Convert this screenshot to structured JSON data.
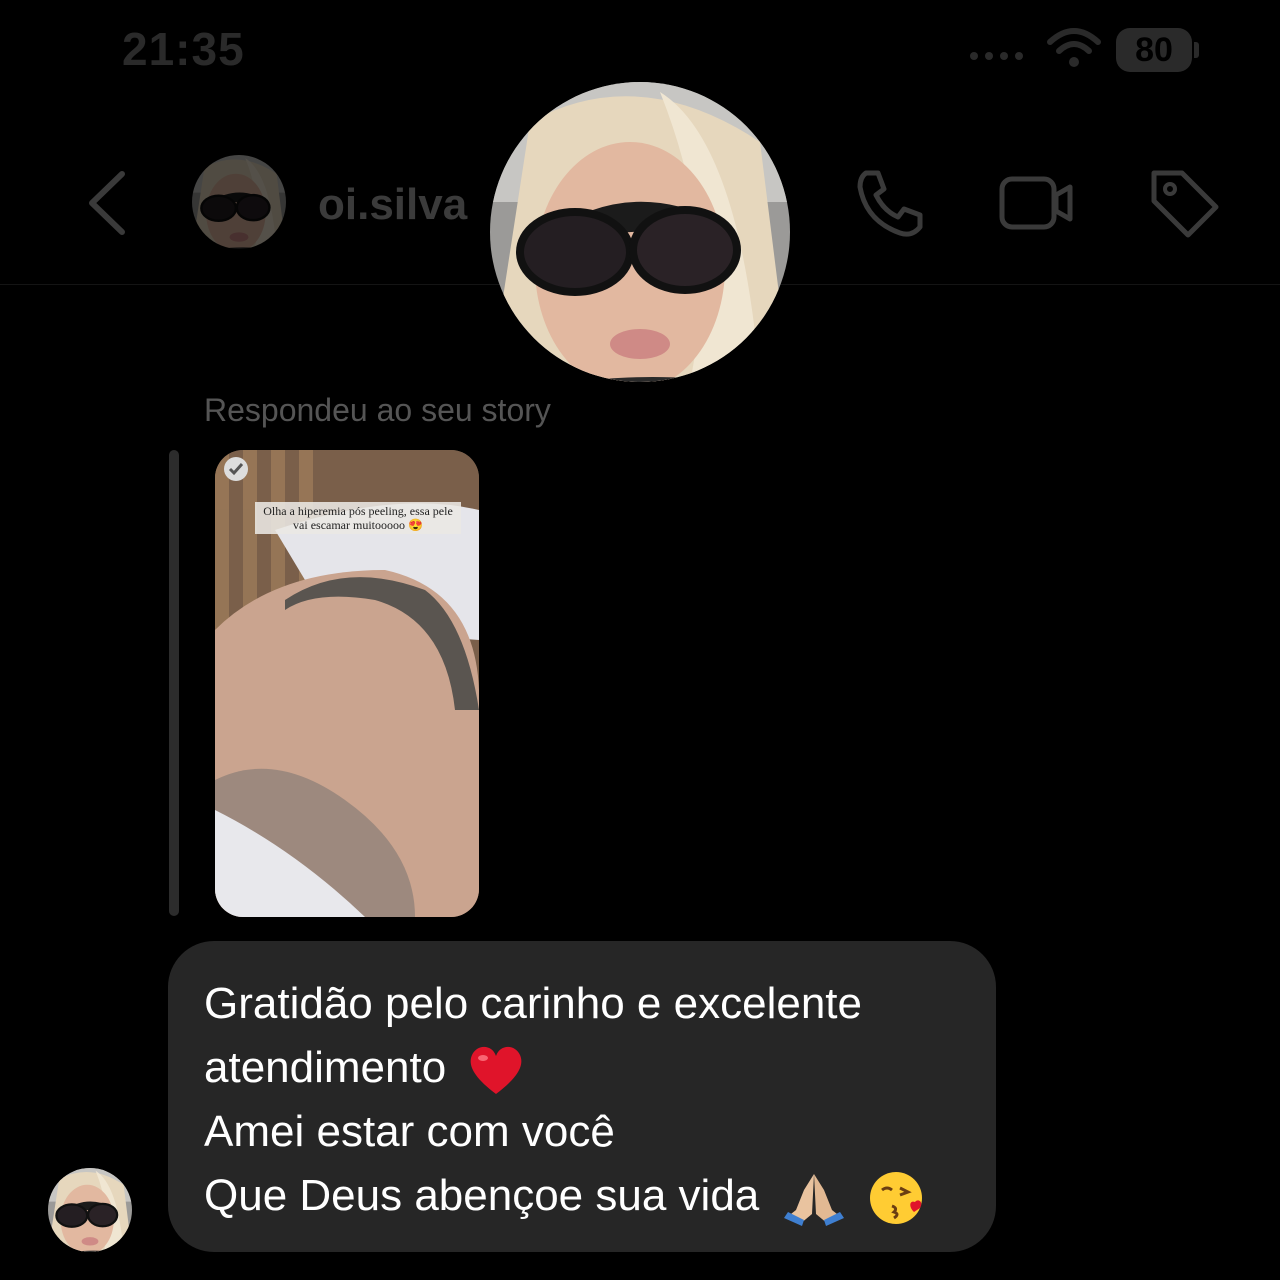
{
  "status_bar": {
    "time": "21:35",
    "battery": "80"
  },
  "header": {
    "username": "oi.silva"
  },
  "thread": {
    "replied_label": "Respondeu ao seu story",
    "story_caption": "Olha a hiperemia pós peeling, essa pele vai escamar muitooooo 😍",
    "message_lines": [
      "Gratidão pelo carinho e excelente",
      "atendimento",
      "Amei estar com você",
      "Que Deus abençoe sua vida"
    ]
  },
  "colors": {
    "bubble": "#262626",
    "background": "#000000",
    "muted_text": "#555555"
  }
}
